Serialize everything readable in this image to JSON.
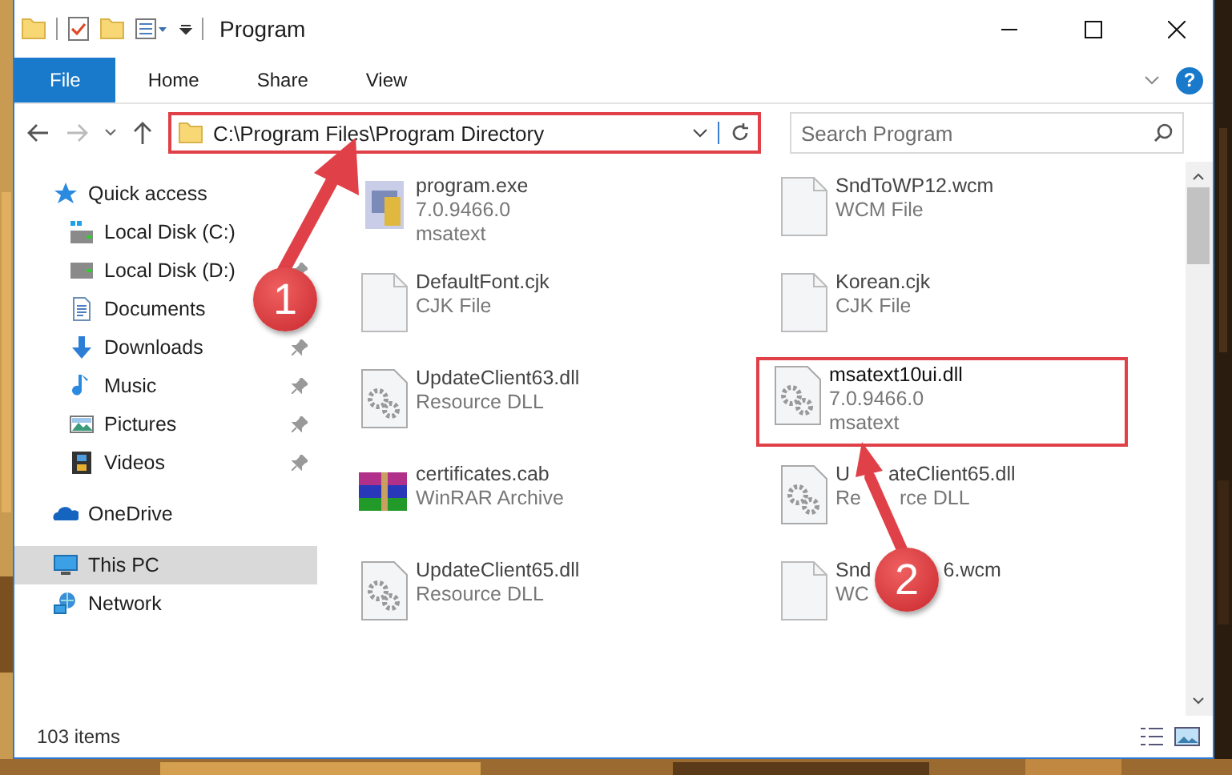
{
  "window": {
    "title": "Program"
  },
  "ribbon": {
    "tabs": [
      {
        "label": "File",
        "selected": true
      },
      {
        "label": "Home",
        "selected": false
      },
      {
        "label": "Share",
        "selected": false
      },
      {
        "label": "View",
        "selected": false
      }
    ],
    "help": "?"
  },
  "address": {
    "path": "C:\\Program Files\\Program Directory",
    "highlighted": true
  },
  "search": {
    "placeholder": "Search Program"
  },
  "sidebar": {
    "items": [
      {
        "label": "Quick access",
        "selected": false,
        "pinned": false,
        "children": [
          {
            "label": "Local Disk (C:)",
            "selected": false,
            "pinned": false
          },
          {
            "label": "Local Disk (D:)",
            "selected": false,
            "pinned": true
          },
          {
            "label": "Documents",
            "selected": false,
            "pinned": false
          },
          {
            "label": "Downloads",
            "selected": false,
            "pinned": true
          },
          {
            "label": "Music",
            "selected": false,
            "pinned": true
          },
          {
            "label": "Pictures",
            "selected": false,
            "pinned": true
          },
          {
            "label": "Videos",
            "selected": false,
            "pinned": true
          }
        ]
      },
      {
        "label": "OneDrive",
        "selected": false,
        "pinned": false
      },
      {
        "label": "This PC",
        "selected": true,
        "pinned": false
      },
      {
        "label": "Network",
        "selected": false,
        "pinned": false
      }
    ]
  },
  "files": [
    {
      "kind": "exe",
      "name_parts": [
        "program.exe"
      ],
      "details": [
        [
          "7.0.9466.0"
        ],
        [
          "msatext"
        ]
      ],
      "highlighted": false
    },
    {
      "kind": "blank",
      "name_parts": [
        "SndToWP12.wcm"
      ],
      "details": [
        [
          "WCM File"
        ]
      ],
      "highlighted": false
    },
    {
      "kind": "blank",
      "name_parts": [
        "DefaultFont.cjk"
      ],
      "details": [
        [
          "CJK File"
        ]
      ],
      "highlighted": false
    },
    {
      "kind": "blank",
      "name_parts": [
        "Korean.cjk"
      ],
      "details": [
        [
          "CJK File"
        ]
      ],
      "highlighted": false
    },
    {
      "kind": "dll",
      "name_parts": [
        "UpdateClient63.dll"
      ],
      "details": [
        [
          "Resource DLL"
        ]
      ],
      "highlighted": false
    },
    {
      "kind": "dll",
      "name_parts": [
        "msatext10ui.dll"
      ],
      "details": [
        [
          "7.0.9466.0"
        ],
        [
          "msatext"
        ]
      ],
      "highlighted": true
    },
    {
      "kind": "archive",
      "name_parts": [
        "certificates.cab"
      ],
      "details": [
        [
          "WinRAR Archive"
        ]
      ],
      "highlighted": false
    },
    {
      "kind": "dll",
      "name_parts": [
        "U",
        "ateClient65.dll"
      ],
      "details": [
        [
          "Re",
          "rce DLL"
        ]
      ],
      "highlighted": false
    },
    {
      "kind": "dll",
      "name_parts": [
        "UpdateClient65.dll"
      ],
      "details": [
        [
          "Resource DLL"
        ]
      ],
      "highlighted": false
    },
    {
      "kind": "blank",
      "name_parts": [
        "Snd",
        "6.wcm"
      ],
      "details": [
        [
          "WC"
        ]
      ],
      "highlighted": false
    }
  ],
  "status_bar": {
    "count": "103 items"
  },
  "annotations": [
    {
      "number": "1"
    },
    {
      "number": "2"
    }
  ]
}
